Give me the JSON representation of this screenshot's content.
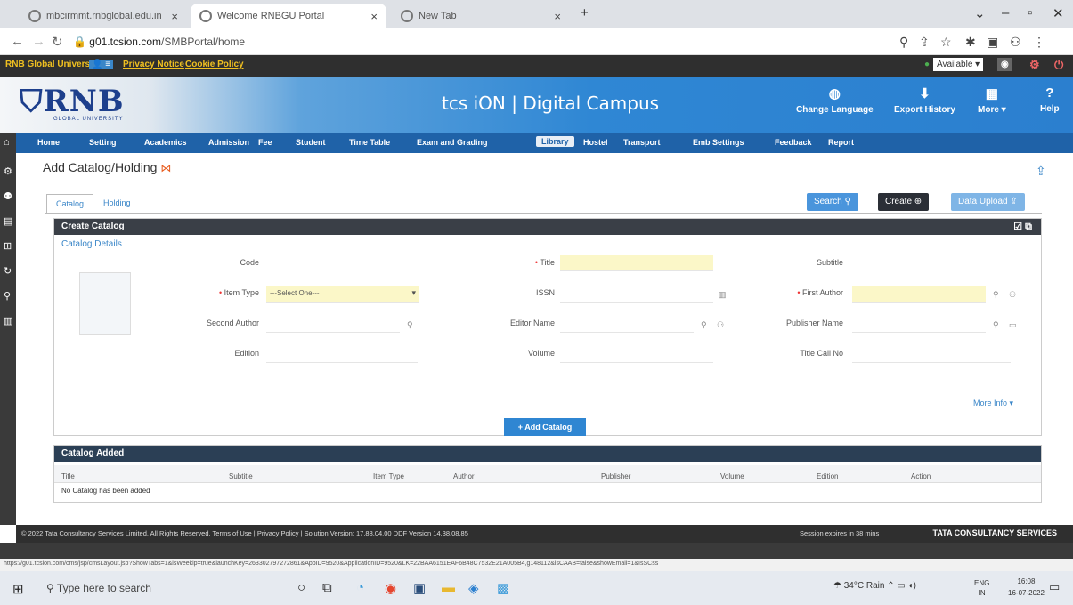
{
  "browser": {
    "tabs": [
      {
        "label": "mbcirmmt.rnbglobal.edu.in",
        "close": "×"
      },
      {
        "label": "Welcome RNBGU Portal",
        "close": "×"
      },
      {
        "label": "New Tab",
        "close": "×"
      }
    ],
    "new_tab": "+",
    "url_host": "g01.tcsion.com",
    "url_path": "/SMBPortal/home"
  },
  "notice": {
    "university": "RNB Global University",
    "privacy": "Privacy Notice",
    "cookie": "Cookie Policy",
    "status": "Available"
  },
  "header": {
    "logo": "RNB",
    "logo_sub": "GLOBAL UNIVERSITY",
    "brand": "tcs iON | Digital Campus",
    "buttons": [
      {
        "label": "Change Language",
        "icon": "globe-icon"
      },
      {
        "label": "Export History",
        "icon": "download-icon"
      },
      {
        "label": "More",
        "icon": "grid-icon"
      },
      {
        "label": "Help",
        "icon": "help-icon"
      }
    ]
  },
  "modules": [
    "Home",
    "Setting",
    "Academics",
    "Admission",
    "Fee",
    "Student",
    "Time Table",
    "Exam and Grading",
    "Library",
    "Hostel",
    "Transport",
    "Emb Settings",
    "Feedback",
    "Report"
  ],
  "page": {
    "title": "Add Catalog/Holding",
    "tabs": [
      "Catalog",
      "Holding"
    ],
    "actions": {
      "search": "Search",
      "create": "Create",
      "upload": "Data Upload"
    }
  },
  "create_panel": {
    "title": "Create Catalog",
    "section": "Catalog Details",
    "fields": {
      "code": "Code",
      "title": "Title",
      "subtitle": "Subtitle",
      "item_type": "Item Type",
      "item_type_value": "---Select One---",
      "issn": "ISSN",
      "first_author": "First Author",
      "second_author": "Second Author",
      "editor_name": "Editor Name",
      "publisher_name": "Publisher Name",
      "edition": "Edition",
      "volume": "Volume",
      "title_call_no": "Title Call No"
    },
    "more_info": "More Info",
    "add_button": "+ Add Catalog"
  },
  "added_panel": {
    "title": "Catalog Added",
    "columns": [
      "Title",
      "Subtitle",
      "Item Type",
      "Author",
      "Publisher",
      "Volume",
      "Edition",
      "Action"
    ],
    "empty": "No Catalog has been added"
  },
  "footer": {
    "left": "© 2022 Tata Consultancy Services Limited. All Rights Reserved.   Terms of Use | Privacy Policy | Solution Version: 17.88.04.00   DDF Version 14.38.08.85",
    "session": "Session expires in 38 mins",
    "brand": "TATA CONSULTANCY SERVICES"
  },
  "status_url": "https://g01.tcsion.com/cms/jsp/cmsLayout.jsp?ShowTabs=1&isWeeklp=true&launchKey=263302797272861&AppID=9520&ApplicationID=9520&LK=22BAA6151EAF6B48C7532E21A005B4,g148112&isCAAB=false&showEmail=1&IsSCss",
  "taskbar": {
    "search": "Type here to search",
    "weather": "34°C Rain",
    "lang": "ENG",
    "region": "IN",
    "time": "16:08",
    "date": "16-07-2022"
  }
}
